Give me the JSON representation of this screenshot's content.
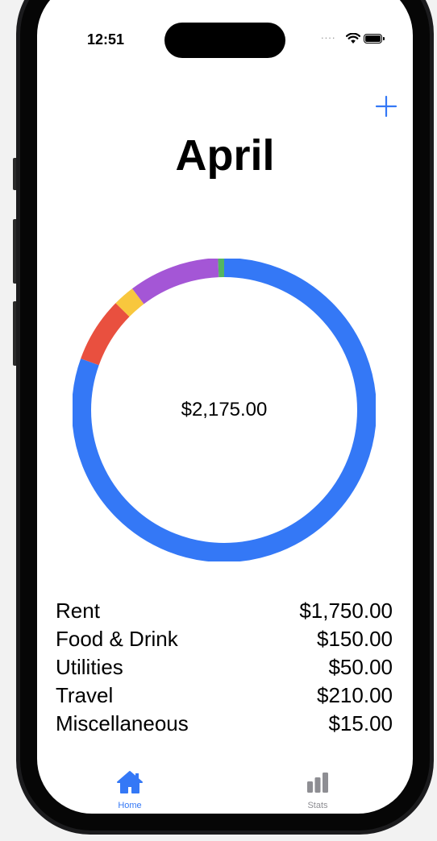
{
  "status_bar": {
    "time": "12:51",
    "signal": "...."
  },
  "header": {
    "add_icon": "plus-icon",
    "title": "April"
  },
  "total": "$2,175.00",
  "categories": [
    {
      "name": "Rent",
      "amount": "$1,750.00",
      "value": 1750,
      "color": "#3478f6"
    },
    {
      "name": "Food & Drink",
      "amount": "$150.00",
      "value": 150,
      "color": "#e9503f"
    },
    {
      "name": "Utilities",
      "amount": "$50.00",
      "value": 50,
      "color": "#f8c73d"
    },
    {
      "name": "Travel",
      "amount": "$210.00",
      "value": 210,
      "color": "#a456d6"
    },
    {
      "name": "Miscellaneous",
      "amount": "$15.00",
      "value": 15,
      "color": "#54b660"
    }
  ],
  "tabs": {
    "home": {
      "label": "Home",
      "icon": "house-icon",
      "active": true,
      "color": "#3478f6"
    },
    "stats": {
      "label": "Stats",
      "icon": "bar-chart-icon",
      "active": false,
      "color": "#8e8e93"
    }
  },
  "colors": {
    "accent": "#3478f6"
  }
}
